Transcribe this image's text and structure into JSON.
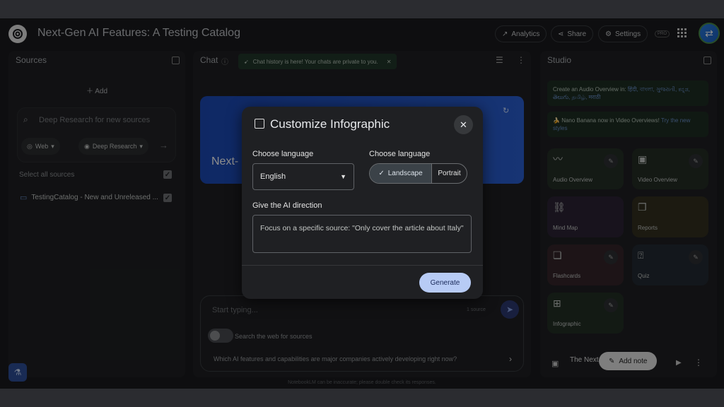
{
  "header": {
    "title": "Next-Gen AI Features: A Testing Catalog",
    "analytics": "Analytics",
    "share": "Share",
    "settings": "Settings",
    "pro": "PRO"
  },
  "sources": {
    "title": "Sources",
    "add": "Add",
    "deep_placeholder": "Deep Research for new sources",
    "web": "Web",
    "deep_research": "Deep Research",
    "select_all": "Select all sources",
    "items": [
      {
        "label": "TestingCatalog - New and Unreleased ..."
      }
    ]
  },
  "chat": {
    "title": "Chat",
    "toast": "Chat history is here! Your chats are private to you.",
    "banner_title": "Next-",
    "input_placeholder": "Start typing...",
    "source_count": "1 source",
    "search_web": "Search the web for sources",
    "suggestion": "Which AI features and capabilities are major companies actively developing right now?",
    "disclaimer": "NotebookLM can be inaccurate; please double check its responses."
  },
  "studio": {
    "title": "Studio",
    "announce_1": "Create an Audio Overview in:",
    "announce_1_langs": "हिंदी, বাংলা, ગુજરાતી, ಕನ್ನಡ, తెలుగు, தமிழ், मराठी",
    "announce_2": "Nano Banana now in Video Overviews!",
    "announce_2_link": "Try the new styles",
    "cards": [
      {
        "label": "Audio Overview",
        "icon": "audio-wave-icon",
        "color": "#253027"
      },
      {
        "label": "Video Overview",
        "icon": "video-icon",
        "color": "#252e25"
      },
      {
        "label": "Mind Map",
        "icon": "mindmap-icon",
        "color": "#2c2436"
      },
      {
        "label": "Reports",
        "icon": "report-icon",
        "color": "#33301f"
      },
      {
        "label": "Flashcards",
        "icon": "flashcards-icon",
        "color": "#35262a"
      },
      {
        "label": "Quiz",
        "icon": "quiz-icon",
        "color": "#232b33"
      },
      {
        "label": "Infographic",
        "icon": "infographic-icon",
        "color": "#243026"
      }
    ],
    "note_title": "The Next",
    "add_note": "Add note"
  },
  "modal": {
    "title": "Customize Infographic",
    "lang_label": "Choose language",
    "lang_value": "English",
    "orient_label": "Choose language",
    "landscape": "Landscape",
    "portrait": "Portrait",
    "direction_label": "Give the AI direction",
    "direction_text": "Focus on a specific source: \"Only cover the article about Italy\"",
    "generate": "Generate"
  },
  "colors": {
    "accent": "#b7cbf5",
    "background": "#1a1b1e",
    "panel": "#1f2023"
  }
}
